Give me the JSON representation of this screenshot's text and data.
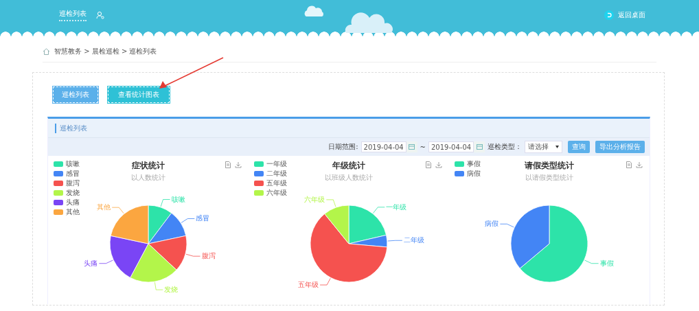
{
  "header": {
    "nav_label": "巡检列表",
    "return_label": "返回桌面"
  },
  "breadcrumb": "智慧教务 > 晨检巡检 > 巡检列表",
  "view_buttons": [
    {
      "label": "巡检列表",
      "selected": false
    },
    {
      "label": "查看统计图表",
      "selected": true
    }
  ],
  "panel": {
    "title": "巡检列表"
  },
  "filters": {
    "date_label": "日期范围:",
    "date_from": "2019-04-04",
    "separator": "~",
    "date_to": "2019-04-04",
    "type_label": "巡检类型：",
    "type_value": "请选择",
    "buttons": [
      "查询",
      "导出分析报告"
    ]
  },
  "charts": [
    {
      "title": "症状统计",
      "subtitle": "以人数统计",
      "legend": [
        {
          "label": "咳嗽",
          "color": "#2de3a9"
        },
        {
          "label": "感冒",
          "color": "#4385f5"
        },
        {
          "label": "腹泻",
          "color": "#f5524f"
        },
        {
          "label": "发烧",
          "color": "#b3f54a"
        },
        {
          "label": "头痛",
          "color": "#7a45f5"
        },
        {
          "label": "其他",
          "color": "#fba640"
        }
      ],
      "slices": [
        {
          "label": "咳嗽",
          "color": "#2de3a9"
        },
        {
          "label": "感冒",
          "color": "#4385f5"
        },
        {
          "label": "腹泻",
          "color": "#f5524f"
        },
        {
          "label": "发烧",
          "color": "#b3f54a"
        },
        {
          "label": "头痛",
          "color": "#7a45f5"
        },
        {
          "label": "其他",
          "color": "#fba640"
        }
      ]
    },
    {
      "title": "年级统计",
      "subtitle": "以班级人数统计",
      "legend": [
        {
          "label": "一年级",
          "color": "#2de3a9"
        },
        {
          "label": "二年级",
          "color": "#4385f5"
        },
        {
          "label": "五年级",
          "color": "#f5524f"
        },
        {
          "label": "六年级",
          "color": "#b3f54a"
        }
      ],
      "slices": [
        {
          "label": "一年级",
          "color": "#2de3a9"
        },
        {
          "label": "二年级",
          "color": "#4385f5"
        },
        {
          "label": "五年级",
          "color": "#f5524f"
        },
        {
          "label": "六年级",
          "color": "#b3f54a"
        }
      ]
    },
    {
      "title": "请假类型统计",
      "subtitle": "以请假类型统计",
      "legend": [
        {
          "label": "事假",
          "color": "#2de3a9"
        },
        {
          "label": "病假",
          "color": "#4385f5"
        }
      ],
      "slices": [
        {
          "label": "事假",
          "color": "#2de3a9"
        },
        {
          "label": "病假",
          "color": "#4385f5"
        }
      ]
    }
  ]
}
